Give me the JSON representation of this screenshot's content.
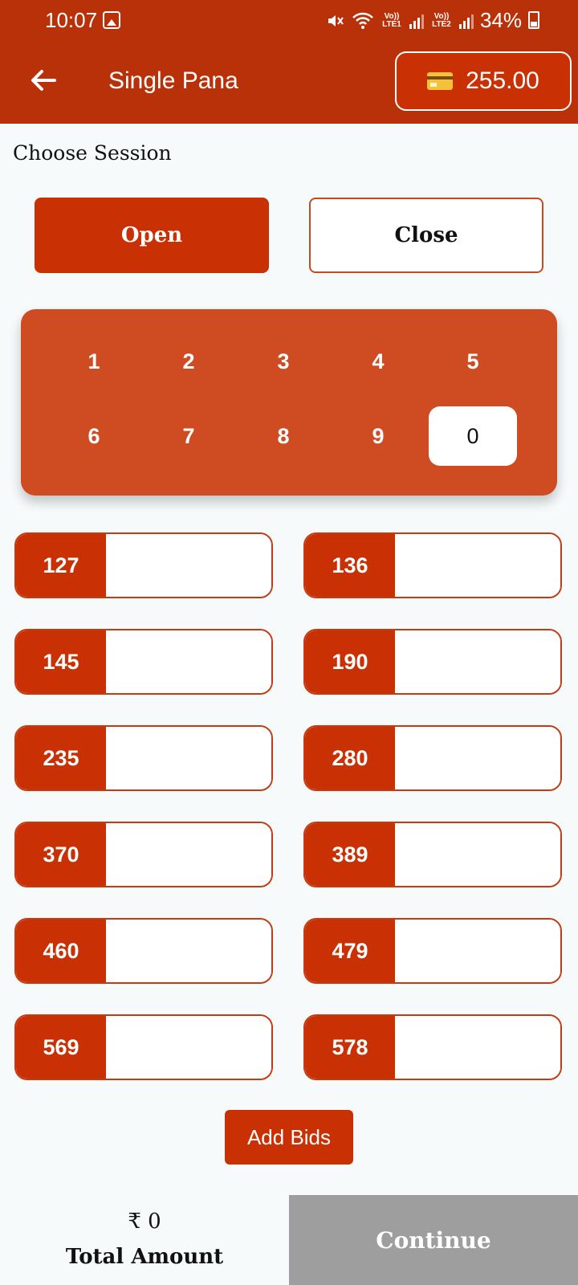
{
  "status_bar": {
    "time": "10:07",
    "lte1": "Vo)) LTE1",
    "lte2": "Vo)) LTE2",
    "battery": "34%"
  },
  "header": {
    "title": "Single Pana",
    "wallet_balance": "255.00"
  },
  "session": {
    "label": "Choose Session",
    "open_label": "Open",
    "close_label": "Close",
    "selected": "Open"
  },
  "digits": [
    "1",
    "2",
    "3",
    "4",
    "5",
    "6",
    "7",
    "8",
    "9",
    "0"
  ],
  "selected_digit": "0",
  "panas": [
    "127",
    "136",
    "145",
    "190",
    "235",
    "280",
    "370",
    "389",
    "460",
    "479",
    "569",
    "578"
  ],
  "add_bids_label": "Add Bids",
  "footer": {
    "amount": "₹ 0",
    "amount_label": "Total Amount",
    "continue_label": "Continue"
  },
  "colors": {
    "primary": "#c93003",
    "header": "#b93109",
    "pad": "#cf4b22",
    "continue_disabled": "#9e9e9e"
  }
}
